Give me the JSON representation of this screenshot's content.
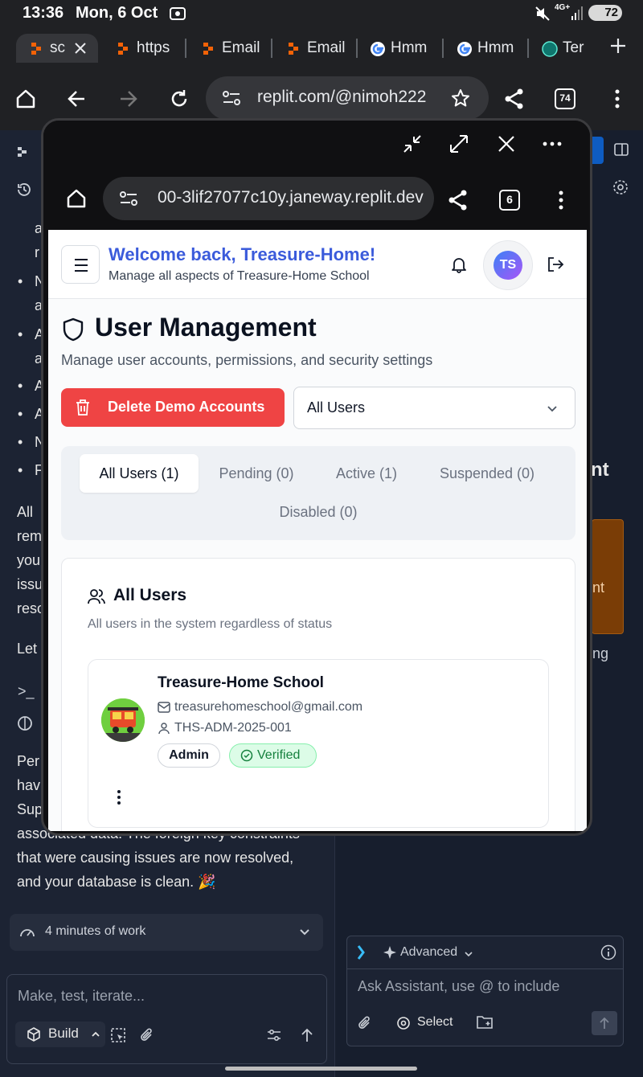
{
  "status_bar": {
    "time": "13:36",
    "date": "Mon, 6 Oct",
    "battery": "72"
  },
  "tabs": [
    {
      "label": "sch",
      "favicon": "replit-favicon",
      "active": true
    },
    {
      "label": "https",
      "favicon": "replit-favicon"
    },
    {
      "label": "Email",
      "favicon": "replit-favicon"
    },
    {
      "label": "Email",
      "favicon": "replit-favicon"
    },
    {
      "label": "Hmm",
      "favicon": "google-favicon"
    },
    {
      "label": "Hmm",
      "favicon": "google-favicon"
    },
    {
      "label": "Ter",
      "favicon": "generic-favicon"
    }
  ],
  "toolbar": {
    "url": "replit.com/@nimoh222",
    "tab_count": "74"
  },
  "popup": {
    "url": "00-3lif27077c10y.janeway.replit.dev",
    "tab_count": "6"
  },
  "app": {
    "welcome": "Welcome back, Treasure-Home!",
    "subtitle": "Manage all aspects of Treasure-Home School",
    "avatar_initials": "TS",
    "page_title": "User Management",
    "page_desc": "Manage user accounts, permissions, and security settings",
    "delete_label": "Delete Demo Accounts",
    "filter_value": "All Users",
    "user_tabs": [
      "All Users (1)",
      "Pending (0)",
      "Active (1)",
      "Suspended (0)",
      "Disabled (0)"
    ],
    "card_title": "All Users",
    "card_desc": "All users in the system regardless of status",
    "user": {
      "name": "Treasure-Home School",
      "email": "treasurehomeschool@gmail.com",
      "id": "THS-ADM-2025-001",
      "role": "Admin",
      "status": "Verified"
    }
  },
  "background": {
    "left_fragments": [
      "a",
      "r",
      "N",
      "a",
      "A",
      "a",
      "A",
      "A",
      "N",
      "F"
    ],
    "para_fragments": [
      "All",
      "rem",
      "you",
      "issu",
      "reso"
    ],
    "let_text": "Let",
    "per_fragments": [
      "Per",
      "hav",
      "Sup"
    ],
    "para_end": [
      "associated data. The foreign key constraints",
      "that were causing issues are now resolved,",
      "and your database is clean. 🎉"
    ],
    "work_label": "4 minutes of work",
    "chat_placeholder": "Make, test, iterate...",
    "build_label": "Build",
    "assistant_mode": "Advanced",
    "assistant_placeholder": "Ask Assistant, use @ to include",
    "select_label": "Select",
    "right_fragments": [
      "nt",
      "nt",
      "ng"
    ]
  }
}
